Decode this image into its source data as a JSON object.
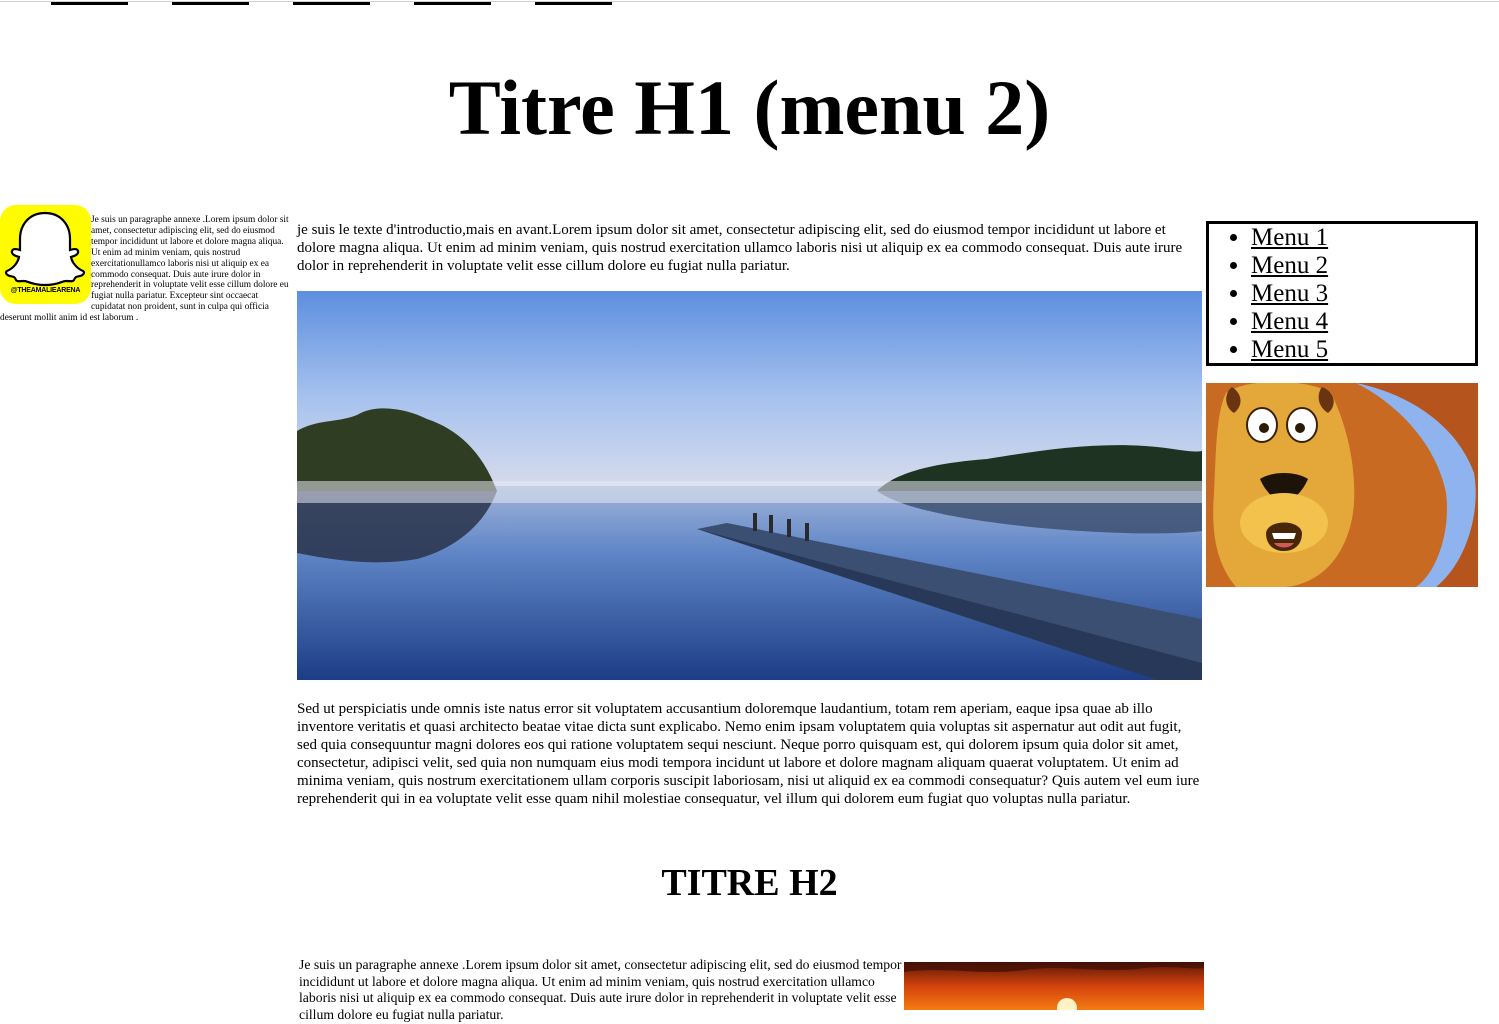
{
  "top_nav": {
    "items": [
      "",
      "",
      "",
      "",
      ""
    ]
  },
  "page": {
    "title": "Titre H1 (menu 2)"
  },
  "left_aside": {
    "logo_handle": "@THEAMALIEARENA",
    "paragraph": "Je suis un paragraphe annexe .Lorem ipsum dolor sit amet, consectetur adipiscing elit, sed do eiusmod tempor incididunt ut labore et dolore magna aliqua. Ut enim ad minim veniam, quis nostrud exercitationullamco laboris nisi ut aliquip ex ea commodo consequat. Duis aute irure dolor in reprehenderit in voluptate velit esse cillum dolore eu fugiat nulla pariatur. Excepteur sint occaecat cupidatat non proident, sunt in culpa qui officia deserunt mollit anim id est laborum ."
  },
  "main": {
    "intro": "je suis le texte d'introductio,mais en avant.Lorem ipsum dolor sit amet, consectetur adipiscing elit, sed do eiusmod tempor incididunt ut labore et dolore magna aliqua. Ut enim ad minim veniam, quis nostrud exercitation ullamco laboris nisi ut aliquip ex ea commodo consequat. Duis aute irure dolor in reprehenderit in voluptate velit esse cillum dolore eu fugiat nulla pariatur.",
    "body": "Sed ut perspiciatis unde omnis iste natus error sit voluptatem accusantium doloremque laudantium, totam rem aperiam, eaque ipsa quae ab illo inventore veritatis et quasi architecto beatae vitae dicta sunt explicabo. Nemo enim ipsam voluptatem quia voluptas sit aspernatur aut odit aut fugit, sed quia consequuntur magni dolores eos qui ratione voluptatem sequi nesciunt. Neque porro quisquam est, qui dolorem ipsum quia dolor sit amet, consectetur, adipisci velit, sed quia non numquam eius modi tempora incidunt ut labore et dolore magnam aliquam quaerat voluptatem. Ut enim ad minima veniam, quis nostrum exercitationem ullam corporis suscipit laboriosam, nisi ut aliquid ex ea commodi consequatur? Quis autem vel eum iure reprehenderit qui in ea voluptate velit esse quam nihil molestiae consequatur, vel illum qui dolorem eum fugiat quo voluptas nulla pariatur.",
    "section_title": "TITRE H2",
    "annex": "Je suis un paragraphe annexe .Lorem ipsum dolor sit amet, consectetur adipiscing elit, sed do eiusmod tempor incididunt ut labore et dolore magna aliqua. Ut enim ad minim veniam, quis nostrud exercitation ullamco laboris nisi ut aliquip ex ea commodo consequat. Duis aute irure dolor in reprehenderit in voluptate velit esse cillum dolore eu fugiat nulla pariatur."
  },
  "right_aside": {
    "menu": [
      "Menu 1",
      "Menu 2",
      "Menu 3",
      "Menu 4",
      "Menu 5"
    ]
  },
  "colors": {
    "snapchat_yellow": "#FFFC00",
    "text": "#000000",
    "background": "#FFFFFF"
  }
}
